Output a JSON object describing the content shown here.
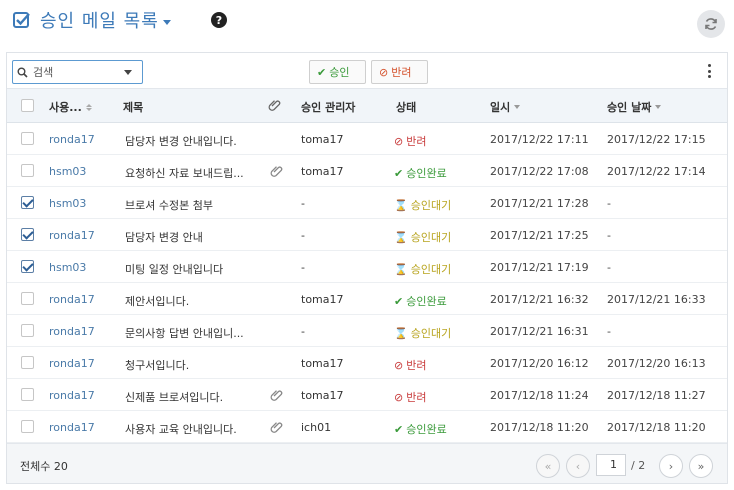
{
  "header": {
    "title": "승인 메일 목록",
    "help": "?"
  },
  "toolbar": {
    "search_label": "검색",
    "approve_label": "승인",
    "reject_label": "반려"
  },
  "columns": {
    "user": "사용...",
    "subject": "제목",
    "manager": "승인 관리자",
    "status": "상태",
    "datetime": "일시",
    "approve_date": "승인 날짜"
  },
  "rows": [
    {
      "user": "ronda17",
      "subject": "담당자 변경 안내입니다.",
      "attach": false,
      "manager": "toma17",
      "status": "반려",
      "status_type": "rejected",
      "datetime": "2017/12/22 17:11",
      "approve_date": "2017/12/22 17:15",
      "checked": false
    },
    {
      "user": "hsm03",
      "subject": "요청하신 자료 보내드립...",
      "attach": true,
      "manager": "toma17",
      "status": "승인완료",
      "status_type": "approved",
      "datetime": "2017/12/22 17:08",
      "approve_date": "2017/12/22 17:14",
      "checked": false
    },
    {
      "user": "hsm03",
      "subject": "브로셔 수정본 첨부",
      "attach": false,
      "manager": "-",
      "status": "승인대기",
      "status_type": "waiting",
      "datetime": "2017/12/21 17:28",
      "approve_date": "-",
      "checked": true
    },
    {
      "user": "ronda17",
      "subject": "담당자 변경 안내",
      "attach": false,
      "manager": "-",
      "status": "승인대기",
      "status_type": "waiting",
      "datetime": "2017/12/21 17:25",
      "approve_date": "-",
      "checked": true
    },
    {
      "user": "hsm03",
      "subject": "미팅 일정 안내입니다",
      "attach": false,
      "manager": "-",
      "status": "승인대기",
      "status_type": "waiting",
      "datetime": "2017/12/21 17:19",
      "approve_date": "-",
      "checked": true
    },
    {
      "user": "ronda17",
      "subject": "제안서입니다.",
      "attach": false,
      "manager": "toma17",
      "status": "승인완료",
      "status_type": "approved",
      "datetime": "2017/12/21 16:32",
      "approve_date": "2017/12/21 16:33",
      "checked": false
    },
    {
      "user": "ronda17",
      "subject": "문의사항 답변 안내입니...",
      "attach": false,
      "manager": "-",
      "status": "승인대기",
      "status_type": "waiting",
      "datetime": "2017/12/21 16:31",
      "approve_date": "-",
      "checked": false
    },
    {
      "user": "ronda17",
      "subject": "청구서입니다.",
      "attach": false,
      "manager": "toma17",
      "status": "반려",
      "status_type": "rejected",
      "datetime": "2017/12/20 16:12",
      "approve_date": "2017/12/20 16:13",
      "checked": false
    },
    {
      "user": "ronda17",
      "subject": "신제품 브로셔입니다.",
      "attach": true,
      "manager": "toma17",
      "status": "반려",
      "status_type": "rejected",
      "datetime": "2017/12/18 11:24",
      "approve_date": "2017/12/18 11:27",
      "checked": false
    },
    {
      "user": "ronda17",
      "subject": "사용자 교육 안내입니다.",
      "attach": true,
      "manager": "ich01",
      "status": "승인완료",
      "status_type": "approved",
      "datetime": "2017/12/18 11:20",
      "approve_date": "2017/12/18 11:20",
      "checked": false
    }
  ],
  "footer": {
    "total_label": "전체수 20",
    "current_page": "1",
    "page_sep": "/ 2"
  },
  "colors": {
    "accent": "#3d7ab8",
    "approved": "#3a9a3a",
    "rejected": "#c83a3a",
    "waiting": "#b8a41e"
  }
}
